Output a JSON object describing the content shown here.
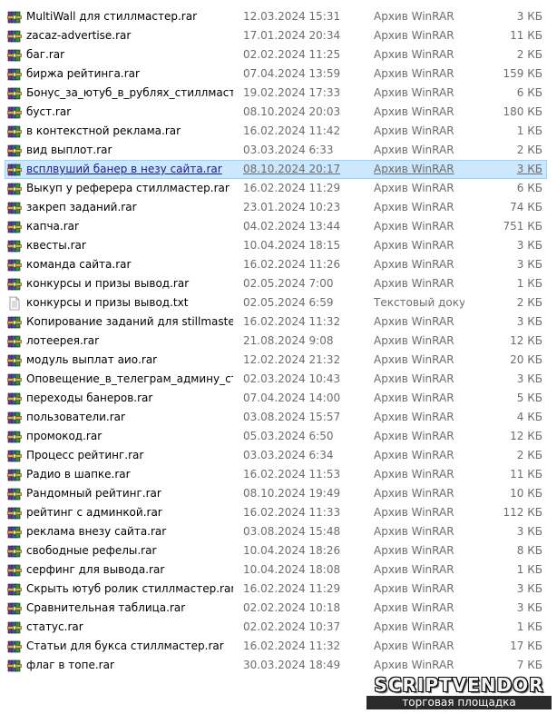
{
  "files": [
    {
      "name": "MultiWall для стиллмастер.rar",
      "date": "12.03.2024 15:31",
      "type": "Архив WinRAR",
      "size": "3 КБ",
      "icon": "winrar-archive-icon"
    },
    {
      "name": "zacaz-advertise.rar",
      "date": "17.01.2024 20:34",
      "type": "Архив WinRAR",
      "size": "11 КБ",
      "icon": "winrar-archive-icon"
    },
    {
      "name": "баг.rar",
      "date": "02.02.2024 11:25",
      "type": "Архив WinRAR",
      "size": "2 КБ",
      "icon": "winrar-archive-icon"
    },
    {
      "name": "биржа рейтинга.rar",
      "date": "07.04.2024 13:59",
      "type": "Архив WinRAR",
      "size": "159 КБ",
      "icon": "winrar-archive-icon"
    },
    {
      "name": "Бонус_за_ютуб_в_рублях_стиллмастер....",
      "date": "19.02.2024 17:33",
      "type": "Архив WinRAR",
      "size": "6 КБ",
      "icon": "winrar-archive-icon"
    },
    {
      "name": "буст.rar",
      "date": "08.10.2024 20:03",
      "type": "Архив WinRAR",
      "size": "180 КБ",
      "icon": "winrar-archive-icon"
    },
    {
      "name": "в контекстной реклама.rar",
      "date": "16.02.2024 11:42",
      "type": "Архив WinRAR",
      "size": "1 КБ",
      "icon": "winrar-archive-icon"
    },
    {
      "name": "вид выплот.rar",
      "date": "03.03.2024 6:33",
      "type": "Архив WinRAR",
      "size": "2 КБ",
      "icon": "winrar-archive-icon"
    },
    {
      "name": "всплвуший банер в незу сайта.rar",
      "date": "08.10.2024 20:17",
      "type": "Архив WinRAR",
      "size": "3 КБ",
      "icon": "winrar-archive-icon",
      "selected": true
    },
    {
      "name": "Выкуп у реферера стиллмастер.rar",
      "date": "16.02.2024 11:29",
      "type": "Архив WinRAR",
      "size": "6 КБ",
      "icon": "winrar-archive-icon"
    },
    {
      "name": "закреп заданий.rar",
      "date": "23.01.2024 10:23",
      "type": "Архив WinRAR",
      "size": "74 КБ",
      "icon": "winrar-archive-icon"
    },
    {
      "name": "капча.rar",
      "date": "04.02.2024 13:44",
      "type": "Архив WinRAR",
      "size": "751 КБ",
      "icon": "winrar-archive-icon"
    },
    {
      "name": "квесты.rar",
      "date": "10.04.2024 18:15",
      "type": "Архив WinRAR",
      "size": "3 КБ",
      "icon": "winrar-archive-icon"
    },
    {
      "name": "команда сайта.rar",
      "date": "16.02.2024 11:26",
      "type": "Архив WinRAR",
      "size": "3 КБ",
      "icon": "winrar-archive-icon"
    },
    {
      "name": "конкурсы и призы вывод.rar",
      "date": "02.05.2024 7:00",
      "type": "Архив WinRAR",
      "size": "1 КБ",
      "icon": "winrar-archive-icon"
    },
    {
      "name": "конкурсы и призы вывод.txt",
      "date": "02.05.2024 6:59",
      "type": "Текстовый докум...",
      "size": "2 КБ",
      "icon": "text-document-icon"
    },
    {
      "name": "Копирование заданий для stillmaster.rar",
      "date": "16.02.2024 11:32",
      "type": "Архив WinRAR",
      "size": "3 КБ",
      "icon": "winrar-archive-icon"
    },
    {
      "name": "лотеерея.rar",
      "date": "21.08.2024 9:08",
      "type": "Архив WinRAR",
      "size": "12 КБ",
      "icon": "winrar-archive-icon"
    },
    {
      "name": "модуль выплат aио.rar",
      "date": "12.02.2024 21:32",
      "type": "Архив WinRAR",
      "size": "20 КБ",
      "icon": "winrar-archive-icon"
    },
    {
      "name": "Оповещение_в_телеграм_админу_стил...",
      "date": "02.03.2024 10:43",
      "type": "Архив WinRAR",
      "size": "3 КБ",
      "icon": "winrar-archive-icon"
    },
    {
      "name": "переходы банеров.rar",
      "date": "07.04.2024 14:00",
      "type": "Архив WinRAR",
      "size": "5 КБ",
      "icon": "winrar-archive-icon"
    },
    {
      "name": "пользователи.rar",
      "date": "03.08.2024 15:57",
      "type": "Архив WinRAR",
      "size": "4 КБ",
      "icon": "winrar-archive-icon"
    },
    {
      "name": "промокод.rar",
      "date": "05.03.2024 6:50",
      "type": "Архив WinRAR",
      "size": "12 КБ",
      "icon": "winrar-archive-icon"
    },
    {
      "name": "Процесс рейтинг.rar",
      "date": "03.03.2024 6:34",
      "type": "Архив WinRAR",
      "size": "2 КБ",
      "icon": "winrar-archive-icon"
    },
    {
      "name": "Радио в шапке.rar",
      "date": "16.02.2024 11:53",
      "type": "Архив WinRAR",
      "size": "11 КБ",
      "icon": "winrar-archive-icon"
    },
    {
      "name": "Рандомный рейтинг.rar",
      "date": "08.10.2024 19:49",
      "type": "Архив WinRAR",
      "size": "10 КБ",
      "icon": "winrar-archive-icon"
    },
    {
      "name": "рейтинг с админкой.rar",
      "date": "16.02.2024 11:33",
      "type": "Архив WinRAR",
      "size": "112 КБ",
      "icon": "winrar-archive-icon"
    },
    {
      "name": "реклама внезу сайта.rar",
      "date": "03.08.2024 15:48",
      "type": "Архив WinRAR",
      "size": "3 КБ",
      "icon": "winrar-archive-icon"
    },
    {
      "name": "свободные рефелы.rar",
      "date": "10.04.2024 18:26",
      "type": "Архив WinRAR",
      "size": "8 КБ",
      "icon": "winrar-archive-icon"
    },
    {
      "name": "серфинг для вывода.rar",
      "date": "10.04.2024 18:08",
      "type": "Архив WinRAR",
      "size": "1 КБ",
      "icon": "winrar-archive-icon"
    },
    {
      "name": "Скрыть ютуб ролик стиллмастер.rar",
      "date": "16.02.2024 11:29",
      "type": "Архив WinRAR",
      "size": "3 КБ",
      "icon": "winrar-archive-icon"
    },
    {
      "name": "Сравнительная таблица.rar",
      "date": "02.02.2024 10:18",
      "type": "Архив WinRAR",
      "size": "3 КБ",
      "icon": "winrar-archive-icon"
    },
    {
      "name": "статус.rar",
      "date": "02.02.2024 10:37",
      "type": "Архив WinRAR",
      "size": "1 КБ",
      "icon": "winrar-archive-icon"
    },
    {
      "name": "Статьи для букса стиллмастер.rar",
      "date": "16.02.2024 11:32",
      "type": "Архив WinRAR",
      "size": "17 КБ",
      "icon": "winrar-archive-icon"
    },
    {
      "name": "флаг в топе.rar",
      "date": "30.03.2024 18:49",
      "type": "Архив WinRAR",
      "size": "7 КБ",
      "icon": "winrar-archive-icon"
    }
  ],
  "watermark": {
    "brand": "SCRIPTVENDOR",
    "subtitle": "торговая площадка"
  },
  "colors": {
    "selection_bg": "#cce8ff",
    "selection_border": "#99d1ff",
    "secondary_text": "#6d6d6d"
  }
}
